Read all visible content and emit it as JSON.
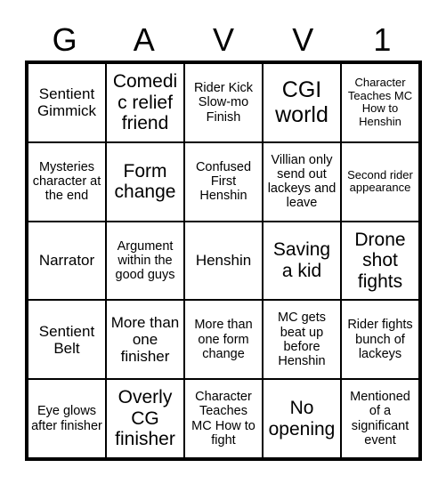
{
  "card": {
    "title_letters": [
      "G",
      "A",
      "V",
      "V",
      "1"
    ],
    "columns": 5,
    "rows": 5,
    "border_color": "#000000",
    "background_color": "#ffffff",
    "text_color": "#000000",
    "cells": [
      {
        "text": "Sentient Gimmick",
        "size": "md"
      },
      {
        "text": "Comedic relief friend",
        "size": "lg"
      },
      {
        "text": "Rider Kick Slow-mo Finish",
        "size": "sm"
      },
      {
        "text": "CGI world",
        "size": "xl"
      },
      {
        "text": "Character Teaches MC How to Henshin",
        "size": "xs"
      },
      {
        "text": "Mysteries character at the end",
        "size": "sm"
      },
      {
        "text": "Form change",
        "size": "lg"
      },
      {
        "text": "Confused First Henshin",
        "size": "sm"
      },
      {
        "text": "Villian only send out lackeys and leave",
        "size": "sm"
      },
      {
        "text": "Second rider appearance",
        "size": "xs"
      },
      {
        "text": "Narrator",
        "size": "md"
      },
      {
        "text": "Argument within the good guys",
        "size": "sm"
      },
      {
        "text": "Henshin",
        "size": "md"
      },
      {
        "text": "Saving a kid",
        "size": "lg"
      },
      {
        "text": "Drone shot fights",
        "size": "lg"
      },
      {
        "text": "Sentient Belt",
        "size": "md"
      },
      {
        "text": "More than one finisher",
        "size": "md"
      },
      {
        "text": "More than one form change",
        "size": "sm"
      },
      {
        "text": "MC gets beat up before Henshin",
        "size": "sm"
      },
      {
        "text": "Rider fights bunch of lackeys",
        "size": "sm"
      },
      {
        "text": "Eye glows after finisher",
        "size": "sm"
      },
      {
        "text": "Overly CG finisher",
        "size": "lg"
      },
      {
        "text": "Character Teaches MC How to fight",
        "size": "sm"
      },
      {
        "text": "No opening",
        "size": "lg"
      },
      {
        "text": "Mentioned of a significant event",
        "size": "sm"
      }
    ]
  }
}
